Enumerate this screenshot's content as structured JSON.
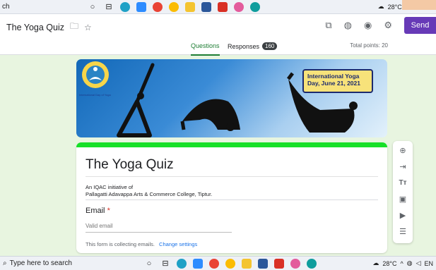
{
  "taskbar_top": {
    "search_text": "ch",
    "weather": "28°C",
    "tray_glyphs": "^ ⊕ ◍ ◁×"
  },
  "header": {
    "form_title": "The Yoga Quiz",
    "send_label": "Send"
  },
  "tabs": {
    "questions": "Questions",
    "responses": "Responses",
    "responses_count": "160",
    "total_points": "Total points: 20"
  },
  "banner": {
    "announcement": "International Yoga Day, June 21, 2021",
    "logo_caption": "International Day of Yoga"
  },
  "form_card": {
    "title": "The Yoga Quiz",
    "description_line1": "An IQAC initiative of",
    "description_line2": "Pallagatti Adavappa Arts & Commerce College, Tiptur.",
    "email_label": "Email",
    "required_mark": "*",
    "email_placeholder": "Valid email",
    "collect_note": "This form is collecting emails.",
    "change_settings": "Change settings",
    "accent_color": "#17e028"
  },
  "side_toolbar": [
    "add-question-icon",
    "import-questions-icon",
    "add-title-icon",
    "add-image-icon",
    "add-video-icon",
    "add-section-icon"
  ],
  "taskbar_bottom": {
    "search_placeholder": "Type here to search",
    "weather": "28°C",
    "lang": "EN"
  },
  "colors": {
    "brand_purple": "#673ab7",
    "page_background": "#e8f5e0",
    "active_tab": "#1e7e34"
  }
}
